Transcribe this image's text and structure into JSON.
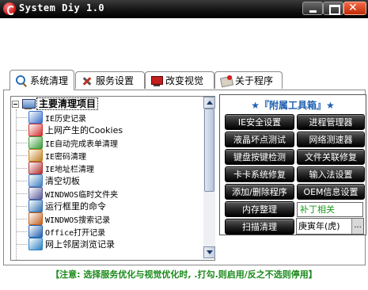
{
  "window": {
    "title": "System Diy 1.0"
  },
  "tabs": [
    {
      "label": "系统清理",
      "icon": "search-icon"
    },
    {
      "label": "服务设置",
      "icon": "tools-icon"
    },
    {
      "label": "改变视觉",
      "icon": "monitor-icon"
    },
    {
      "label": "关于程序",
      "icon": "info-icon"
    }
  ],
  "tree": {
    "root_label": "主要清理项目",
    "items": [
      {
        "label": "IE历史记录",
        "icon": "history-icon",
        "color": "#3a6fc8"
      },
      {
        "label": "上网产生的Cookies",
        "icon": "cookies-icon",
        "color": "#d03030"
      },
      {
        "label": "IE自动完成表单清理",
        "icon": "form-icon",
        "color": "#3a9a3a"
      },
      {
        "label": "IE密码清理",
        "icon": "password-icon",
        "color": "#c08020"
      },
      {
        "label": "IE地址栏清理",
        "icon": "address-icon",
        "color": "#b03030"
      },
      {
        "label": "清空切板",
        "icon": "clipboard-icon",
        "color": "#4080c0"
      },
      {
        "label": "WINDWOS临时文件夹",
        "icon": "temp-folder-icon",
        "color": "#5a5a9a"
      },
      {
        "label": "运行框里的命令",
        "icon": "run-icon",
        "color": "#3070b0"
      },
      {
        "label": "WINDWOS搜索记录",
        "icon": "search-record-icon",
        "color": "#c06020"
      },
      {
        "label": "Office打开记录",
        "icon": "office-icon",
        "color": "#2060b0"
      },
      {
        "label": "网上邻居浏览记录",
        "icon": "network-icon",
        "color": "#2a80c0"
      }
    ]
  },
  "tools": {
    "title": "★『附属工具箱』★",
    "buttons": [
      {
        "label": "IE安全设置"
      },
      {
        "label": "进程管理器"
      },
      {
        "label": "液晶坏点测试"
      },
      {
        "label": "网络测速器"
      },
      {
        "label": "键盘按键检测"
      },
      {
        "label": "文件关联修复"
      },
      {
        "label": "卡卡系统修复"
      },
      {
        "label": "输入法设置"
      },
      {
        "label": "添加/删除程序"
      },
      {
        "label": "OEM信息设置"
      },
      {
        "label": "内存整理"
      },
      {
        "label": "扫描清理"
      }
    ],
    "patch_label": "补丁相关",
    "date_value": "庚寅年(虎)",
    "date_button": "..."
  },
  "status_text": "【注意: 选择服务优化与视觉优化时, .打勾.则启用/反之不选则停用】",
  "colors": {
    "accent": "#1f5fb0",
    "status_green": "#1a8a1a",
    "patch_green": "#1a9a1a"
  }
}
